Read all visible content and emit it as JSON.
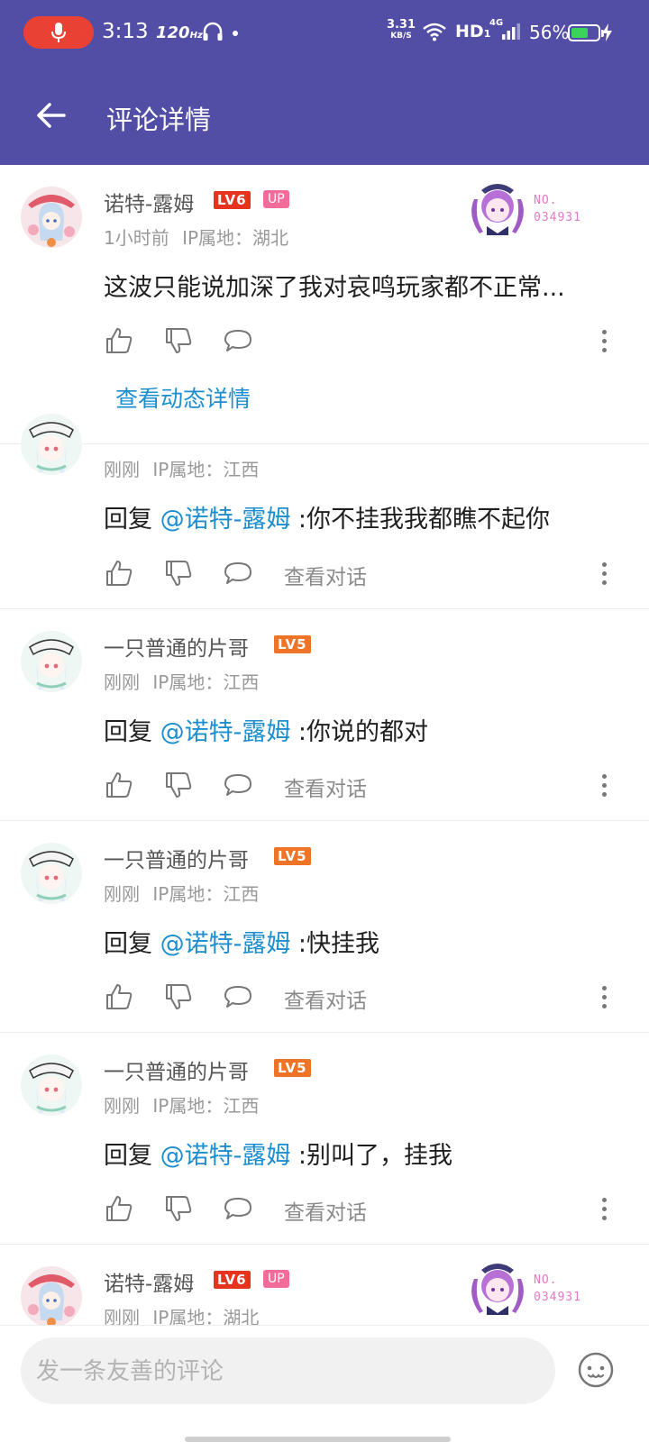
{
  "status_bar": {
    "time": "3:13",
    "refresh_rate": "120",
    "refresh_unit": "Hz",
    "net_speed_value": "3.31",
    "net_speed_unit": "KB/S",
    "hd_label": "HD",
    "hd_sub": "1",
    "network_type": "4G",
    "battery_percent": "56%",
    "battery_level": 0.56,
    "icons": [
      "mic-icon",
      "headphones-icon",
      "wifi-icon",
      "signal-icon",
      "battery-icon",
      "charging-icon"
    ]
  },
  "app_bar": {
    "title": "评论详情",
    "back_icon": "back-arrow-icon"
  },
  "theme": {
    "app_bar_color": "#524da5",
    "mention_color": "#1c8ecf",
    "lv6_color": "#e5331f",
    "lv5_color": "#f07427",
    "up_badge_color": "#f36b98",
    "fan_badge_color": "#e479c6"
  },
  "main_comment": {
    "username": "诺特-露姆",
    "level": "LV6",
    "up_badge": "UP",
    "time": "1小时前",
    "ip_label": "IP属地：湖北",
    "text": "这波只能说加深了我对哀鸣玩家都不正常...",
    "fan_badge": {
      "no_label": "NO.",
      "number": "034931"
    },
    "view_dynamic_label": "查看动态详情"
  },
  "replies": [
    {
      "username": "",
      "time": "刚刚",
      "ip_label": "IP属地：江西",
      "prefix": "回复 ",
      "mention": "@诺特-露姆",
      "text": " :你不挂我我都瞧不起你",
      "view_convo_label": "查看对话"
    },
    {
      "username": "一只普通的片哥",
      "level": "LV5",
      "time": "刚刚",
      "ip_label": "IP属地：江西",
      "prefix": "回复 ",
      "mention": "@诺特-露姆",
      "text": " :你说的都对",
      "view_convo_label": "查看对话"
    },
    {
      "username": "一只普通的片哥",
      "level": "LV5",
      "time": "刚刚",
      "ip_label": "IP属地：江西",
      "prefix": "回复 ",
      "mention": "@诺特-露姆",
      "text": " :快挂我",
      "view_convo_label": "查看对话"
    },
    {
      "username": "一只普通的片哥",
      "level": "LV5",
      "time": "刚刚",
      "ip_label": "IP属地：江西",
      "prefix": "回复 ",
      "mention": "@诺特-露姆",
      "text": " :别叫了，挂我",
      "view_convo_label": "查看对话"
    },
    {
      "username": "诺特-露姆",
      "level": "LV6",
      "up_badge": "UP",
      "time": "刚刚",
      "ip_label": "IP属地：湖北",
      "fan_badge": {
        "no_label": "NO.",
        "number": "034931"
      }
    }
  ],
  "comment_bar": {
    "placeholder": "发一条友善的评论",
    "emoji_icon": "emoji-icon"
  }
}
